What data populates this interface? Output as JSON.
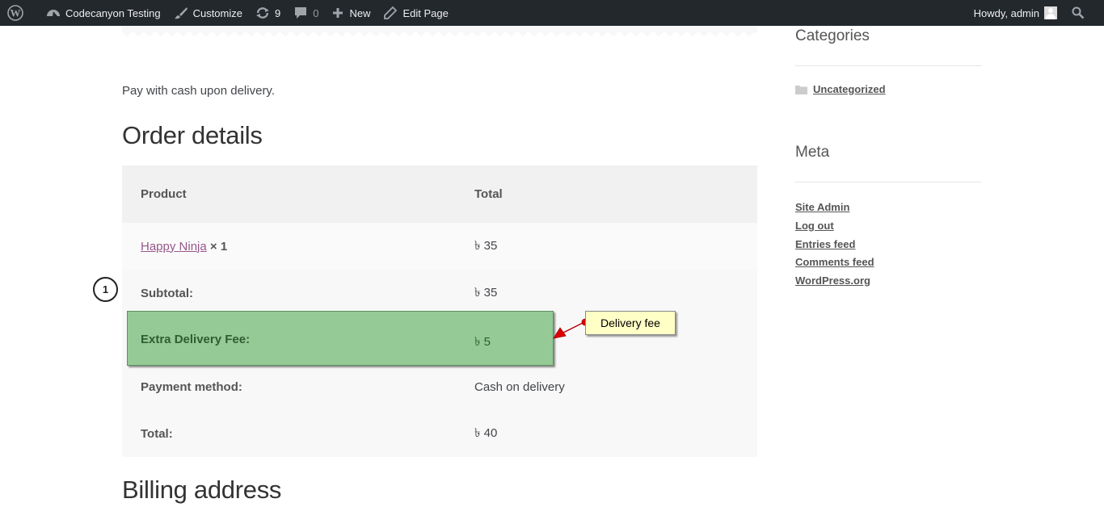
{
  "adminbar": {
    "site_name": "Codecanyon Testing",
    "customize": "Customize",
    "updates_count": "9",
    "comments_count": "0",
    "new": "New",
    "edit_page": "Edit Page",
    "howdy": "Howdy, admin"
  },
  "content": {
    "pay_text": "Pay with cash upon delivery.",
    "order_details_title": "Order details",
    "table": {
      "col_product": "Product",
      "col_total": "Total",
      "product_name": "Happy Ninja",
      "product_qty": "× 1",
      "product_total": "৳ 35",
      "rows": [
        {
          "label": "Subtotal:",
          "value": "৳ 35"
        },
        {
          "label": "Extra Delivery Fee:",
          "value": "৳ 5"
        },
        {
          "label": "Payment method:",
          "value": "Cash on delivery"
        },
        {
          "label": "Total:",
          "value": "৳ 40"
        }
      ]
    },
    "billing_title": "Billing address"
  },
  "annotation": {
    "step_number": "1",
    "callout_text": "Delivery fee",
    "highlight_color": "#93c994",
    "callout_color": "#ffffc6",
    "arrow_color": "#e00000"
  },
  "sidebar": {
    "categories_title": "Categories",
    "categories": [
      "Uncategorized"
    ],
    "meta_title": "Meta",
    "meta_links": [
      "Site Admin",
      "Log out",
      "Entries feed",
      "Comments feed",
      "WordPress.org"
    ]
  }
}
